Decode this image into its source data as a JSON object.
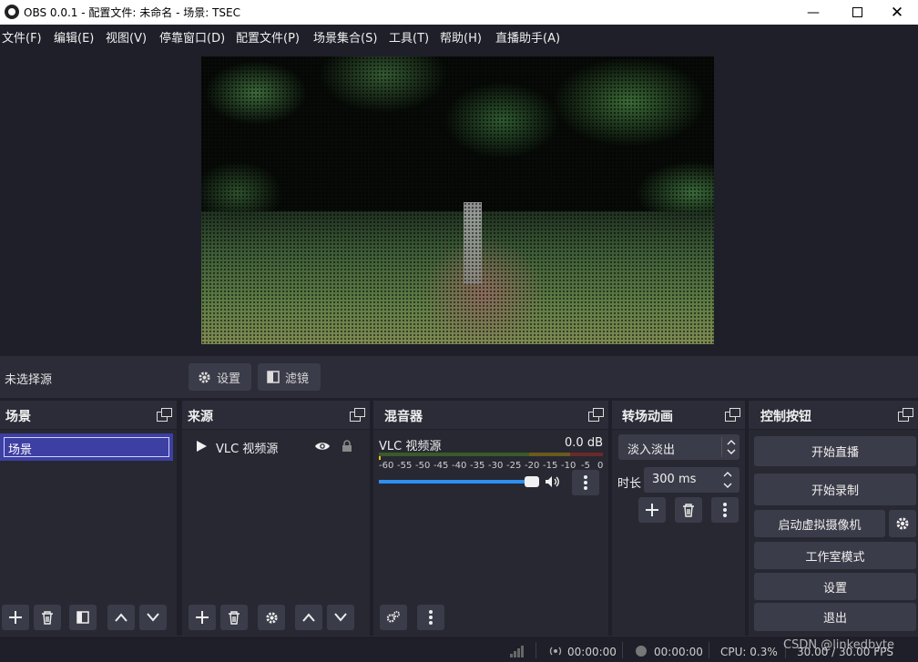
{
  "window": {
    "title": "OBS 0.0.1 - 配置文件: 未命名 - 场景: TSEC"
  },
  "menu": [
    "文件(F)",
    "编辑(E)",
    "视图(V)",
    "停靠窗口(D)",
    "配置文件(P)",
    "场景集合(S)",
    "工具(T)",
    "帮助(H)",
    "直播助手(A)"
  ],
  "context_bar": {
    "source_label": "未选择源",
    "settings_label": "设置",
    "filters_label": "滤镜"
  },
  "docks": {
    "scenes": {
      "title": "场景",
      "editing_value": "场景"
    },
    "sources": {
      "title": "来源",
      "items": [
        {
          "name": "VLC 视频源"
        }
      ]
    },
    "mixer": {
      "title": "混音器",
      "channel": {
        "name": "VLC 视频源",
        "level": "0.0 dB",
        "volume_fraction": 1.0
      },
      "scale": [
        "-60",
        "-55",
        "-50",
        "-45",
        "-40",
        "-35",
        "-30",
        "-25",
        "-20",
        "-15",
        "-10",
        "-5",
        "0"
      ]
    },
    "transitions": {
      "title": "转场动画",
      "selected": "淡入淡出",
      "duration_label": "时长",
      "duration_value": "300 ms"
    },
    "controls": {
      "title": "控制按钮",
      "start_stream": "开始直播",
      "start_record": "开始录制",
      "virtual_cam": "启动虚拟摄像机",
      "studio_mode": "工作室模式",
      "settings": "设置",
      "exit": "退出"
    }
  },
  "status_bar": {
    "stream_time": "00:00:00",
    "record_time": "00:00:00",
    "cpu": "CPU: 0.3%",
    "fps": "30.00 / 30.00 FPS",
    "watermark": "CSDN @linkedbyte"
  },
  "colors": {
    "background": "#1e1f29",
    "dock": "#2b2c37",
    "button": "#3b3c49",
    "selection": "#3d3fa3",
    "volume": "#2f8ff0"
  }
}
